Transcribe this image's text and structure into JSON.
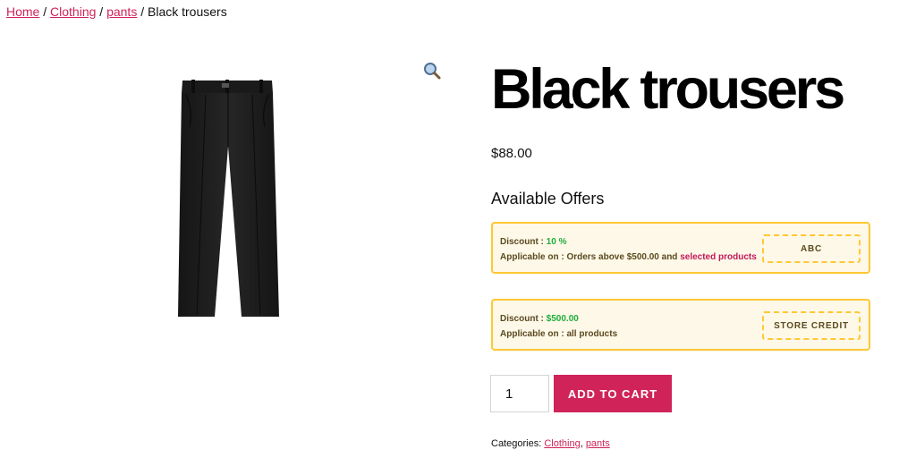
{
  "breadcrumb": {
    "items": [
      "Home",
      "Clothing",
      "pants"
    ],
    "separator": "/",
    "current": "Black trousers"
  },
  "gallery": {
    "zoom_icon": "magnifier-icon",
    "image_alt": "Black trousers product photo"
  },
  "product": {
    "title": "Black trousers",
    "price": "$88.00"
  },
  "offers": {
    "heading": "Available Offers",
    "items": [
      {
        "discount_label": "Discount :",
        "discount_value": "10 %",
        "applicable_label": "Applicable on :",
        "applicable_text": "Orders above $500.00 and",
        "applicable_link": "selected products",
        "coupon_code": "ABC"
      },
      {
        "discount_label": "Discount :",
        "discount_value": "$500.00",
        "applicable_label": "Applicable on :",
        "applicable_text": "all products",
        "applicable_link": "",
        "coupon_code": "STORE CREDIT"
      }
    ]
  },
  "cart": {
    "quantity": "1",
    "button_label": "ADD TO CART"
  },
  "meta": {
    "categories_label": "Categories:",
    "categories": [
      "Clothing",
      "pants"
    ],
    "categories_separator": ","
  },
  "colors": {
    "accent": "#d0235a",
    "offer_border": "#ffc832",
    "offer_bg": "#fdf8e7",
    "discount_value": "#1fae3c"
  }
}
